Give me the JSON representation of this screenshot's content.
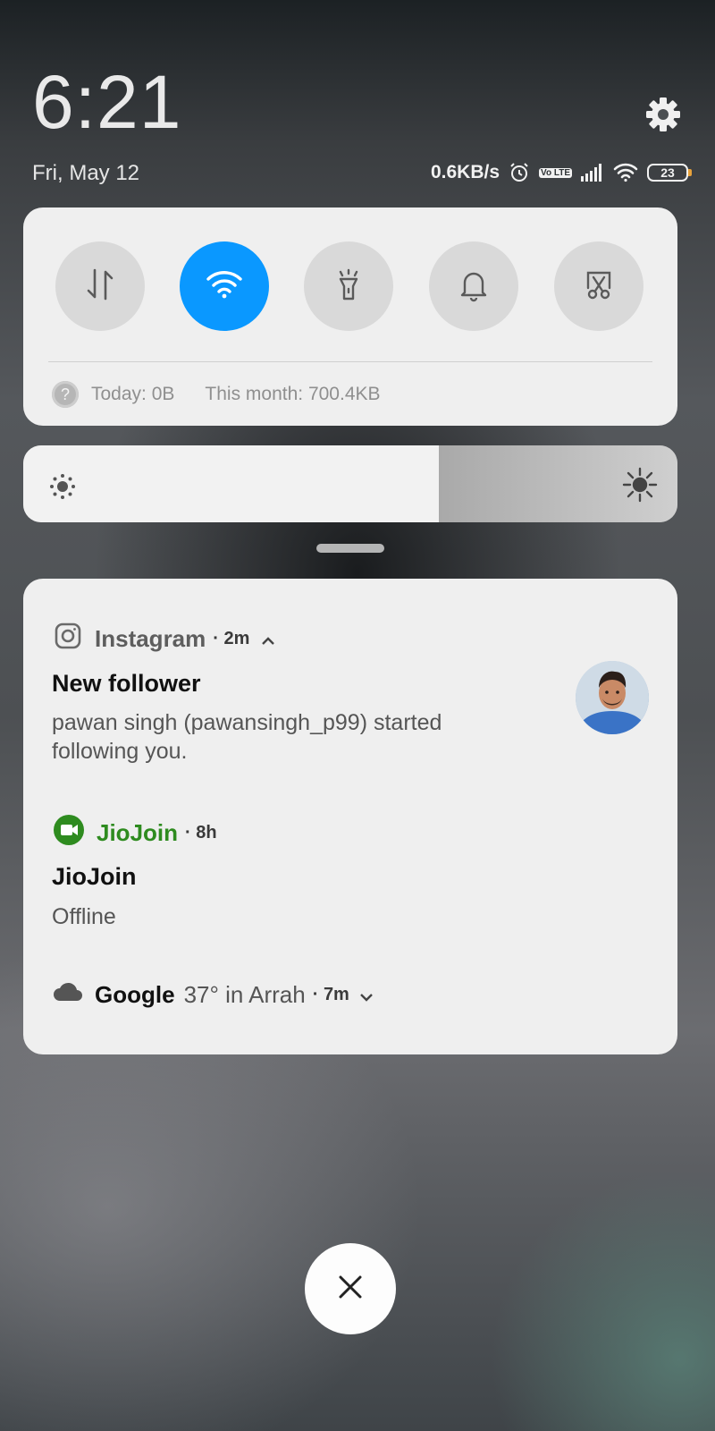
{
  "header": {
    "time": "6:21",
    "date": "Fri, May 12",
    "network_speed": "0.6KB/s",
    "volte_label": "Vo LTE",
    "battery_level": "23",
    "icons": [
      "settings-gear-icon",
      "alarm-clock-icon",
      "signal-bars-icon",
      "wifi-icon",
      "battery-icon"
    ]
  },
  "quick_settings": {
    "tiles": [
      {
        "name": "mobile-data",
        "icon": "data-arrows-icon",
        "active": false
      },
      {
        "name": "wifi",
        "icon": "wifi-icon",
        "active": true
      },
      {
        "name": "flashlight",
        "icon": "flashlight-icon",
        "active": false
      },
      {
        "name": "sound",
        "icon": "bell-icon",
        "active": false
      },
      {
        "name": "screenshot",
        "icon": "scissors-screenshot-icon",
        "active": false
      }
    ],
    "usage_today": "Today: 0B",
    "usage_month": "This month: 700.4KB",
    "accent_color": "#0a98ff"
  },
  "brightness": {
    "level_fraction": 0.635
  },
  "notifications": [
    {
      "app": "Instagram",
      "time": "2m",
      "title": "New follower",
      "body": "pawan singh (pawansingh_p99) started following you.",
      "expanded": true
    },
    {
      "app": "JioJoin",
      "time": "8h",
      "title": "JioJoin",
      "body": "Offline",
      "app_color": "#2e8b1f"
    },
    {
      "app": "Google",
      "summary": "37° in Arrah",
      "time": "7m",
      "expanded": false
    }
  ],
  "close_button_icon": "close-x-icon"
}
